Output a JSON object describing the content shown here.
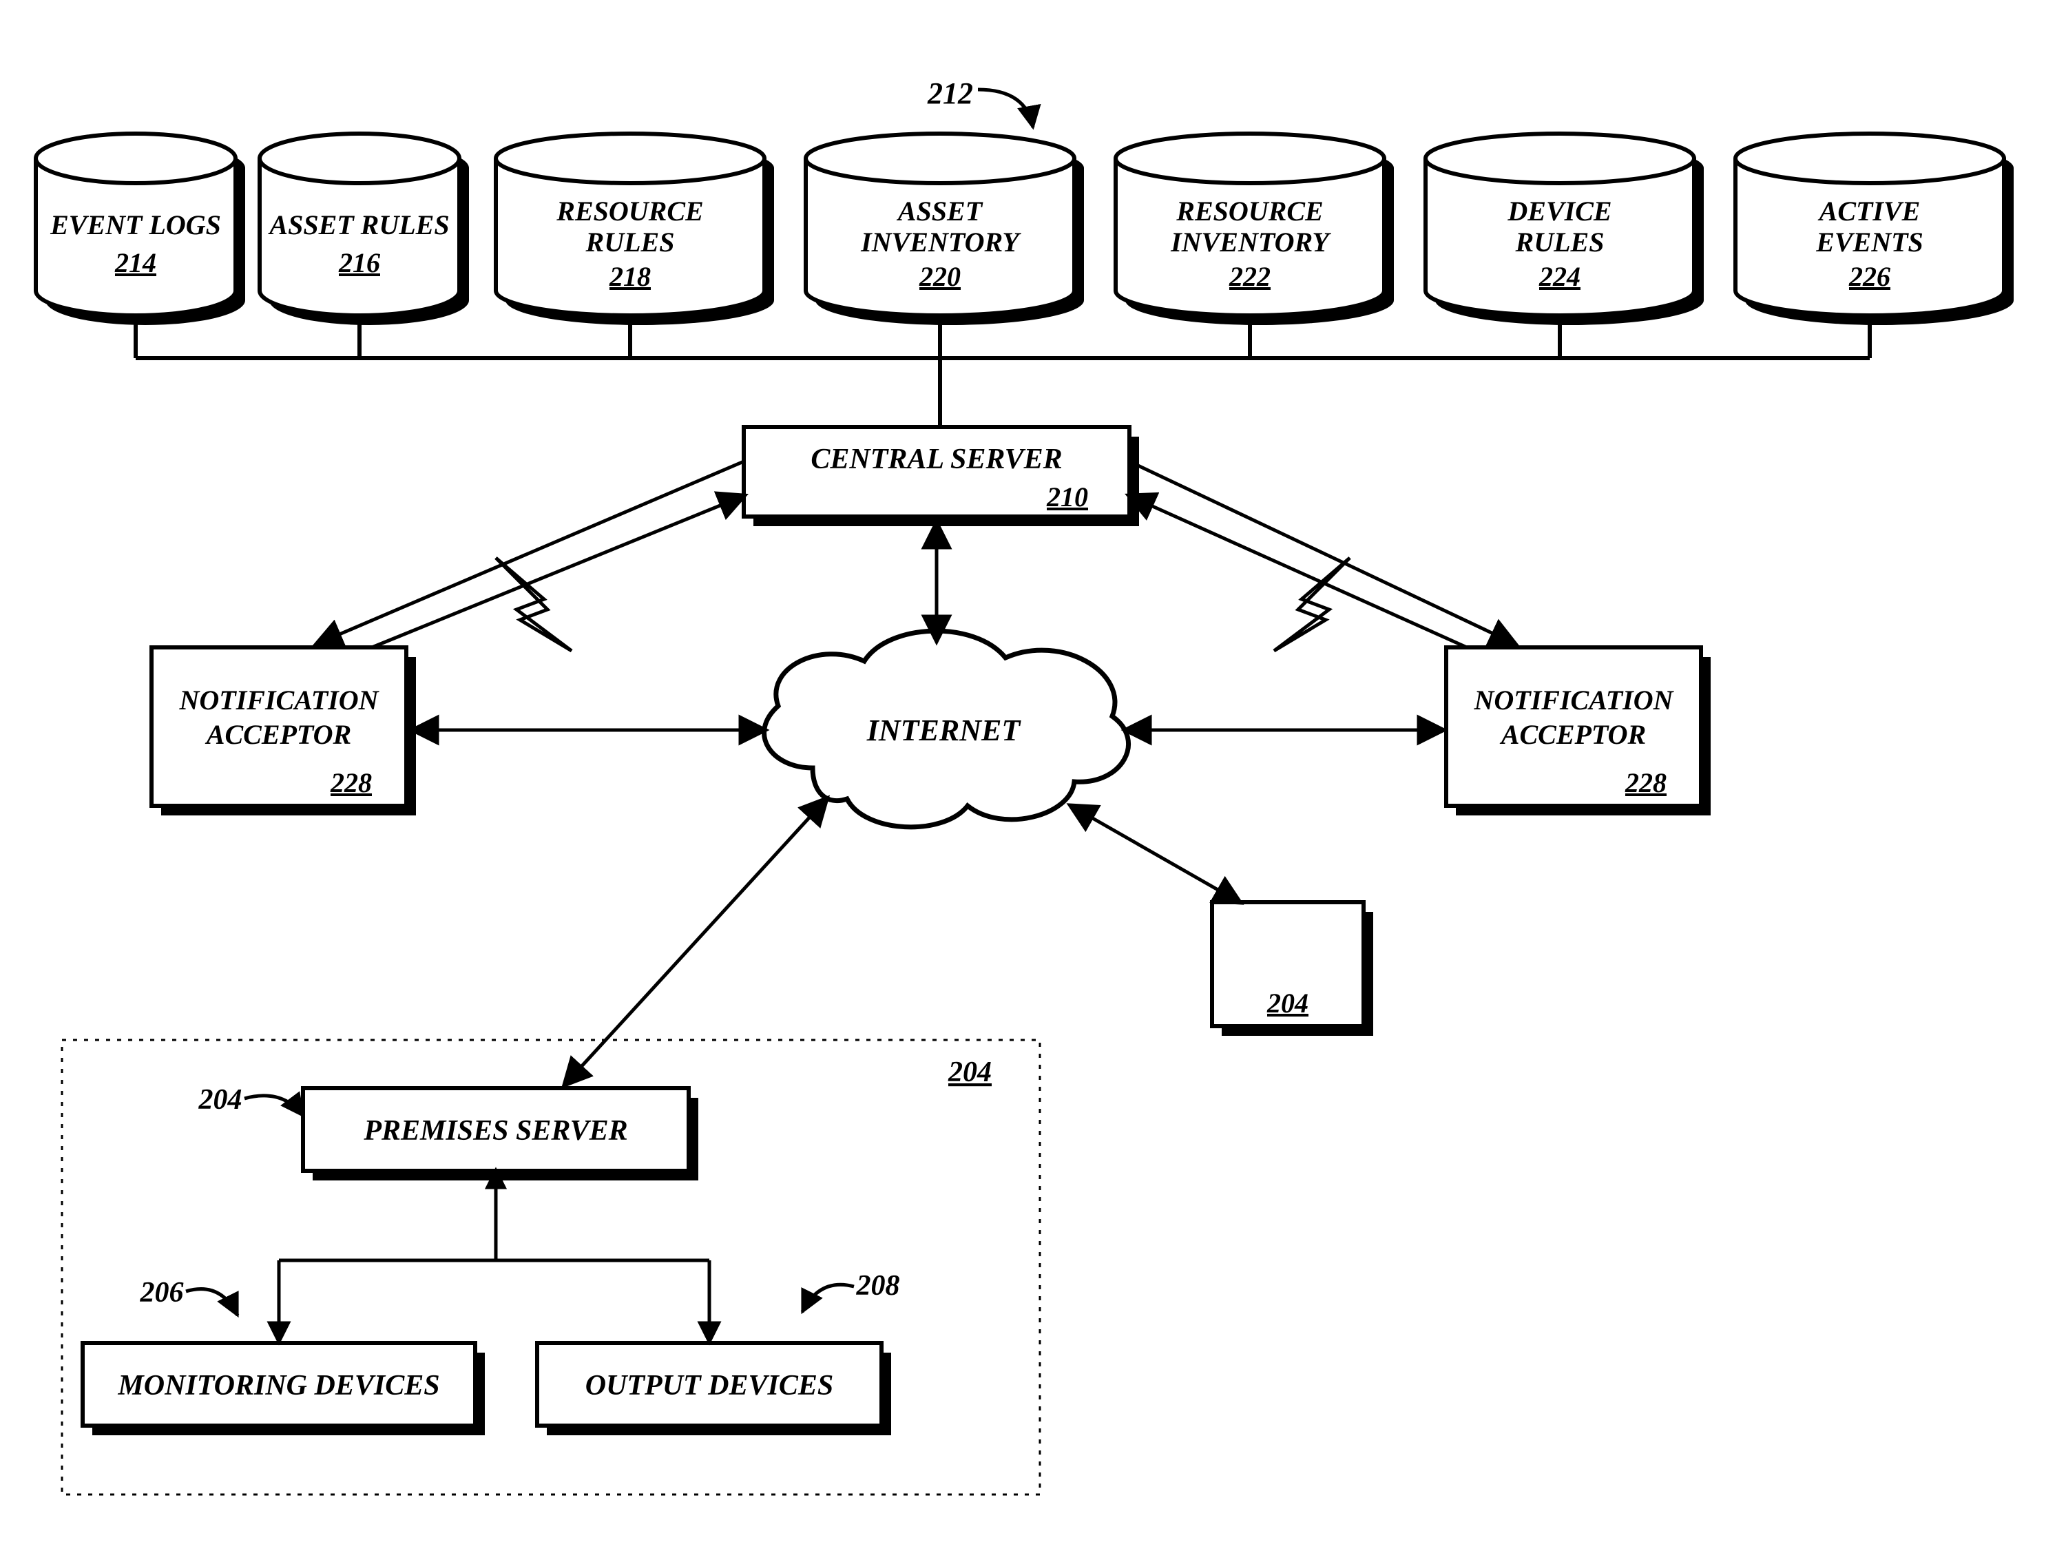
{
  "callouts": {
    "top212": "212",
    "premises204_inside": "204",
    "premises204_left": "204",
    "devices206": "206",
    "devices208": "208"
  },
  "cylinders": [
    {
      "label": "EVENT LOGS",
      "num": "214"
    },
    {
      "label": "ASSET RULES",
      "num": "216"
    },
    {
      "label": "RESOURCE RULES",
      "num": "218"
    },
    {
      "label": "ASSET INVENTORY",
      "num": "220"
    },
    {
      "label": "RESOURCE INVENTORY",
      "num": "222"
    },
    {
      "label": "DEVICE RULES",
      "num": "224"
    },
    {
      "label": "ACTIVE EVENTS",
      "num": "226"
    }
  ],
  "boxes": {
    "central_server": {
      "label": "CENTRAL SERVER",
      "num": "210"
    },
    "notif_left": {
      "label": "NOTIFICATION ACCEPTOR",
      "num": "228"
    },
    "notif_right": {
      "label": "NOTIFICATION ACCEPTOR",
      "num": "228"
    },
    "small_204": {
      "label": "",
      "num": "204"
    },
    "premises_server": {
      "label": "PREMISES SERVER",
      "num": ""
    },
    "monitoring": {
      "label": "MONITORING DEVICES",
      "num": ""
    },
    "output": {
      "label": "OUTPUT DEVICES",
      "num": ""
    }
  },
  "cloud": {
    "label": "INTERNET"
  }
}
